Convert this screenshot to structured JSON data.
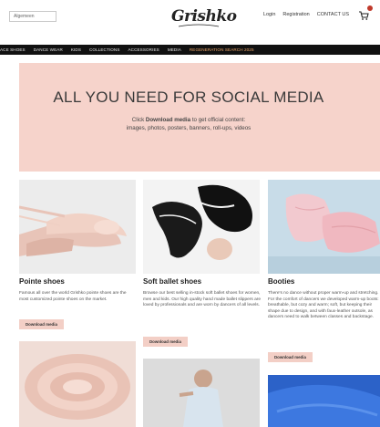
{
  "header": {
    "language": "Algemeen",
    "logo": "Grishko",
    "links": [
      "Login",
      "Registration",
      "CONTACT US"
    ]
  },
  "nav": {
    "items": [
      "ACE SHOES",
      "DANCE WEAR",
      "KIDS",
      "COLLECTIONS",
      "ACCESSORIES",
      "MEDIA"
    ],
    "highlight": "REGENERATION SEARCH 2025"
  },
  "hero": {
    "title": "ALL YOU NEED FOR SOCIAL MEDIA",
    "sub_prefix": "Click",
    "sub_bold": "Download media",
    "sub_suffix": "to get official content:",
    "sub_line2": "images, photos, posters, banners, roll-ups, videos"
  },
  "cards": [
    {
      "title": "Pointe shoes",
      "desc": "Famous all over the world Grishko pointe shoes are the most customized pointe shoes on the market.",
      "button": "Download media"
    },
    {
      "title": "Soft ballet shoes",
      "desc": "Browse our best selling in-stock soft ballet shoes for women, men and kids. Our high quality hand made ballet slippers are loved by professionals and are worn by dancers of all levels.",
      "button": "Download media"
    },
    {
      "title": "Booties",
      "desc": "There's no dance without proper warm-up and stretching. For the comfort of dancers we developed warm-up boots: breathable, but cozy and warm; soft, but keeping their shape due to design, and with faux-leather outsole, as dancers need to walk between classes and backstage.",
      "button": "Download media"
    }
  ],
  "colors": {
    "hero_bg": "#f6d3cb",
    "button_bg": "#f3cfc6",
    "nav_bg": "#111111",
    "nav_highlight": "#f0a86a",
    "cart_badge": "#c0392b"
  }
}
